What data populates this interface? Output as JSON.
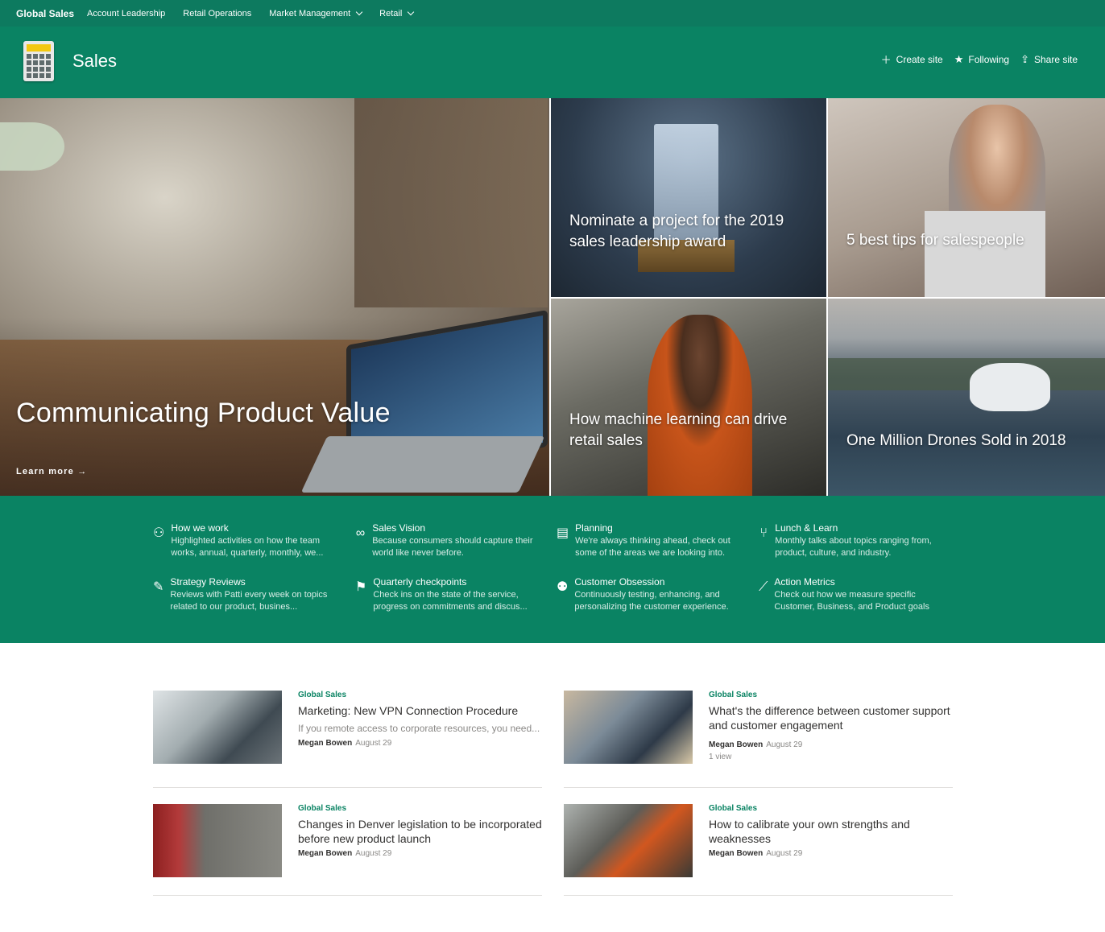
{
  "topnav": {
    "hub": "Global Sales",
    "links": [
      "Account Leadership",
      "Retail Operations",
      "Market Management",
      "Retail"
    ]
  },
  "site": {
    "title": "Sales",
    "actions": {
      "create": "Create site",
      "following": "Following",
      "share": "Share site"
    }
  },
  "hero": {
    "main": {
      "title": "Communicating Product Value",
      "more": "Learn more"
    },
    "tiles": [
      {
        "title": "Nominate a project for the 2019 sales leadership award"
      },
      {
        "title": "5 best tips for salespeople"
      },
      {
        "title": "How machine learning can drive retail sales"
      },
      {
        "title": "One Million Drones Sold in 2018"
      }
    ]
  },
  "quicklinks": [
    {
      "icon": "people-icon",
      "title": "How we work",
      "desc": "Highlighted activities on how the team works, annual, quarterly, monthly, we..."
    },
    {
      "icon": "glasses-icon",
      "title": "Sales Vision",
      "desc": "Because consumers should capture their world like never before."
    },
    {
      "icon": "calendar-icon",
      "title": "Planning",
      "desc": "We're always thinking ahead, check out some of the areas we are looking into."
    },
    {
      "icon": "fork-knife-icon",
      "title": "Lunch & Learn",
      "desc": "Monthly talks about topics ranging from, product, culture, and industry."
    },
    {
      "icon": "edit-note-icon",
      "title": "Strategy Reviews",
      "desc": "Reviews with Patti every week on topics related to our product, busines..."
    },
    {
      "icon": "person-flag-icon",
      "title": "Quarterly checkpoints",
      "desc": "Check ins on the state of the service, progress on commitments and discus..."
    },
    {
      "icon": "group-icon",
      "title": "Customer Obsession",
      "desc": "Continuously testing, enhancing, and personalizing the customer experience."
    },
    {
      "icon": "line-chart-icon",
      "title": "Action Metrics",
      "desc": "Check out how we measure specific Customer, Business, and Product goals"
    }
  ],
  "news": [
    {
      "source": "Global Sales",
      "title": "Marketing: New VPN Connection Procedure",
      "desc": "If you remote access to corporate resources, you need...",
      "author": "Megan Bowen",
      "date": "August 29",
      "views": ""
    },
    {
      "source": "Global Sales",
      "title": "What's the difference between customer support and customer engagement",
      "desc": "",
      "author": "Megan Bowen",
      "date": "August 29",
      "views": "1 view"
    },
    {
      "source": "Global Sales",
      "title": "Changes in Denver legislation to be incorporated before new product launch",
      "desc": "",
      "author": "Megan Bowen",
      "date": "August 29",
      "views": ""
    },
    {
      "source": "Global Sales",
      "title": "How to calibrate your own strengths and weaknesses",
      "desc": "",
      "author": "Megan Bowen",
      "date": "August 29",
      "views": ""
    }
  ],
  "colors": {
    "brand": "#0a8363",
    "topnav": "#0d7a5f"
  }
}
